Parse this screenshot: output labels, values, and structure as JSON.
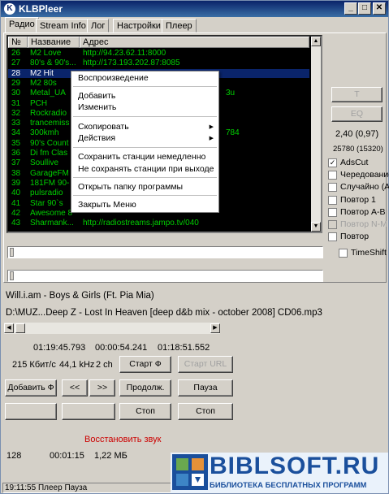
{
  "window": {
    "title": "KLBPleer",
    "minimize_label": "_",
    "maximize_label": "□",
    "close_label": "✕"
  },
  "tabs": [
    {
      "label": "Радио"
    },
    {
      "label": "Stream Info"
    },
    {
      "label": "Лог"
    },
    {
      "label": "Настройки"
    },
    {
      "label": "Плеер"
    }
  ],
  "list": {
    "columns": [
      "№",
      "Название",
      "Адрес"
    ],
    "rows": [
      {
        "num": "26",
        "name": "M2 Love",
        "addr": "http://94.23.62.11:8000"
      },
      {
        "num": "27",
        "name": "80's & 90's...",
        "addr": "http://173.193.202.87:8085"
      },
      {
        "num": "28",
        "name": "M2 Hit",
        "addr": ""
      },
      {
        "num": "29",
        "name": "M2 80s",
        "addr": ""
      },
      {
        "num": "30",
        "name": "Metal_UA",
        "addr": "3u"
      },
      {
        "num": "31",
        "name": "PCH",
        "addr": ""
      },
      {
        "num": "32",
        "name": "Rockradio",
        "addr": ""
      },
      {
        "num": "33",
        "name": "trancemiss",
        "addr": ""
      },
      {
        "num": "34",
        "name": "300kmh",
        "addr": "784"
      },
      {
        "num": "35",
        "name": "90's Count",
        "addr": ""
      },
      {
        "num": "36",
        "name": "Di fm Clas",
        "addr": ""
      },
      {
        "num": "37",
        "name": "Soullive",
        "addr": ""
      },
      {
        "num": "38",
        "name": "GarageFM",
        "addr": ""
      },
      {
        "num": "39",
        "name": "181FM 90-",
        "addr": ""
      },
      {
        "num": "40",
        "name": "pulsradio",
        "addr": ""
      },
      {
        "num": "41",
        "name": "Star 90`s",
        "addr": ""
      },
      {
        "num": "42",
        "name": "Awesome 8",
        "addr": ""
      },
      {
        "num": "43",
        "name": "Sharmank...",
        "addr": "http://radiostreams.jampo.tv/040"
      }
    ]
  },
  "context_menu": {
    "play": "Воспроизведение",
    "add": "Добавить",
    "edit": "Изменить",
    "copy": "Скопировать",
    "actions": "Действия",
    "save_now": "Сохранить станции немедленно",
    "no_save_exit": "Не сохранять станции при выходе",
    "open_folder": "Открыть папку программы",
    "close_menu": "Закрыть Меню"
  },
  "right_panel": {
    "t_button": "T",
    "eq_button": "EQ",
    "ratio": "2,40 (0,97)",
    "counts": "25780 (15320)",
    "checks": [
      {
        "label": "AdsCut",
        "checked": true,
        "enabled": true
      },
      {
        "label": "Чередование",
        "checked": false,
        "enabled": true
      },
      {
        "label": "Случайно (А)",
        "checked": false,
        "enabled": true
      },
      {
        "label": "Повтор 1",
        "checked": false,
        "enabled": true
      },
      {
        "label": "Повтор А-В",
        "checked": false,
        "enabled": true
      },
      {
        "label": "Повтор N-M",
        "checked": false,
        "enabled": false
      },
      {
        "label": "Повтор",
        "checked": false,
        "enabled": true
      }
    ],
    "timeshift": "TimeShift"
  },
  "player": {
    "track": "Will.i.am - Boys & Girls (Ft. Pia Mia)",
    "file": "D:\\MUZ...Deep Z - Lost In Heaven [deep d&b mix - october 2008] CD06.mp3",
    "time_elapsed": "01:19:45.793",
    "time_position": "00:00:54.241",
    "time_total": "01:18:51.552",
    "bitrate": "215 Кбит/с",
    "samplerate": "44,1 kHz",
    "channels": "2 ch",
    "start_f": "Старт Ф",
    "start_url": "Старт URL",
    "add_f": "Добавить Ф",
    "prev": "<<",
    "next": ">>",
    "continue": "Продолж.",
    "pause": "Пауза",
    "stop1": "Стоп",
    "stop2": "Стоп",
    "restore_sound": "Восстановить звук",
    "restore_color": "#cc0000",
    "num": "128",
    "duration": "00:01:15",
    "size": "1,22 МБ"
  },
  "status_bar": "19:11:55 Плеер Пауза",
  "watermark": {
    "brand": "BIBLSOFT.RU",
    "sub": "БИБЛИОТЕКА БЕСПЛАТНЫХ ПРОГРАММ"
  }
}
